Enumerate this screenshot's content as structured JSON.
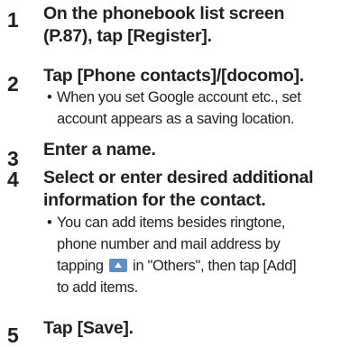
{
  "steps": [
    {
      "number": "1",
      "title_line1": "On the phonebook list screen",
      "title_line2": "(P.87), tap [Register]."
    },
    {
      "number": "2",
      "title_line1": "Tap [Phone contacts]/[docomo].",
      "note_bullet": "•",
      "note_line1": "When you set Google account etc., set",
      "note_line2": "account appears as a saving location."
    },
    {
      "number": "3",
      "title_line1": "Enter a name."
    },
    {
      "number": "4",
      "title_line1": "Select or enter desired additional",
      "title_line2": "information for the contact.",
      "note_bullet": "•",
      "note_line1": "You can add items besides ringtone,",
      "note_line2": "phone number and mail address by",
      "note_line3_before": "tapping ",
      "note_line3_after": " in \"Others\", then tap [Add]",
      "note_line4": "to add items.",
      "icon": "expand-up-icon"
    },
    {
      "number": "5",
      "title_line1": "Tap [Save]."
    }
  ]
}
